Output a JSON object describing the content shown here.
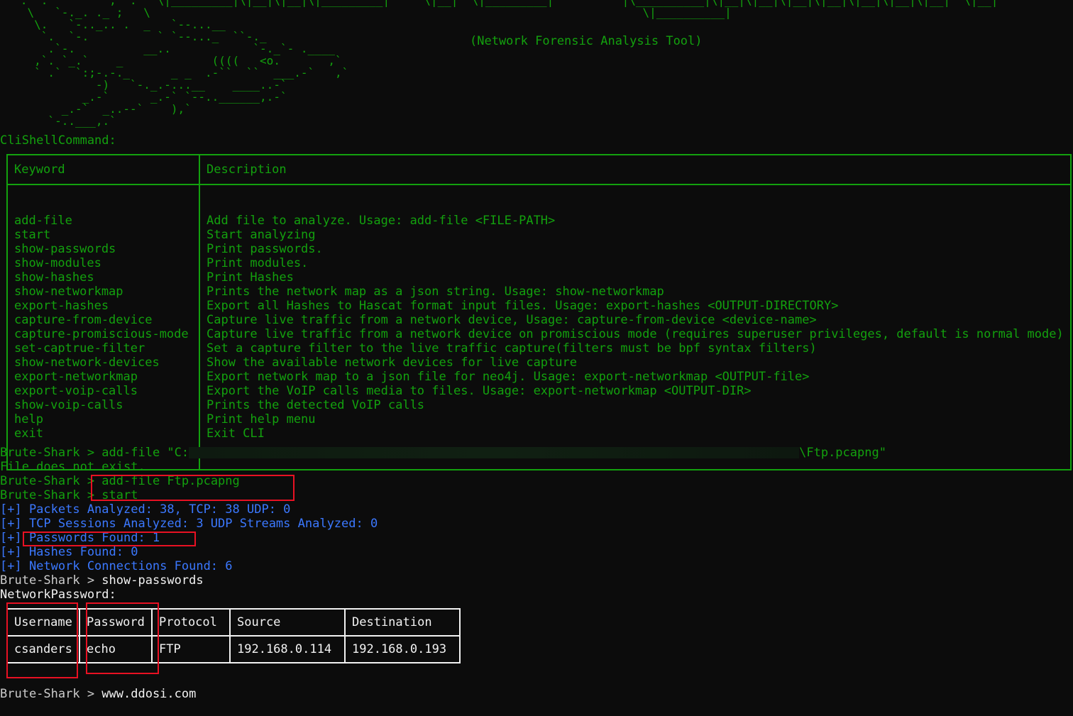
{
  "banner": "   .  .         ,  .   \\|_________|\\|__|\\|__|\\|_________|     \\|__|  \\|_________|          |\\__________|\\|__|\\|__|\\|__|\\|__|\\|__|\\|__|\\|__|  \\|__|\n    \\   `-._. ._ ;   \\                                                                        \\|__________|\n     \\.   `-.._.. .  _   `--...__\n      `.  `-.          ` `--..._  ``-._\n       .`-.          __..            `-._`- .____\n     ,`. `_.`    _             ((((   <o.       ,`\n     ` .`  `:;-.-._      _ _  .-``  ``  ___.-`   ,`\n              -)   `-._.-...__    ____..-`\n            _.-`      _.-` `--..______,.-`\n         _.-`  _..--`    ),`\n       `-..___,.`",
  "subtitle": "(Network Forensic Analysis Tool)",
  "cmd_title": "CliShellCommand:",
  "cmd_table": {
    "headers": [
      "Keyword",
      "Description"
    ],
    "rows": [
      [
        "add-file",
        "Add file to analyze. Usage: add-file <FILE-PATH>"
      ],
      [
        "start",
        "Start analyzing"
      ],
      [
        "show-passwords",
        "Print passwords."
      ],
      [
        "show-modules",
        "Print modules."
      ],
      [
        "show-hashes",
        "Print Hashes"
      ],
      [
        "show-networkmap",
        "Prints the network map as a json string. Usage: show-networkmap"
      ],
      [
        "export-hashes",
        "Export all Hashes to Hascat format input files. Usage: export-hashes <OUTPUT-DIRECTORY>"
      ],
      [
        "capture-from-device",
        "Capture live traffic from a network device, Usage: capture-from-device <device-name>"
      ],
      [
        "capture-promiscious-mode",
        "Capture live traffic from a network device on promiscious mode (requires superuser privileges, default is normal mode)"
      ],
      [
        "set-captrue-filter",
        "Set a capture filter to the live traffic capture(filters must be bpf syntax filters)"
      ],
      [
        "show-network-devices",
        "Show the available network devices for live capture"
      ],
      [
        "export-networkmap",
        "Export network map to a json file for neo4j. Usage: export-networkmap <OUTPUT-file>"
      ],
      [
        "export-voip-calls",
        "Export the VoIP calls media to files. Usage: export-networkmap <OUTPUT-DIR>"
      ],
      [
        "show-voip-calls",
        "Prints the detected VoIP calls"
      ],
      [
        "help",
        "Print help menu"
      ],
      [
        "exit",
        "Exit CLI"
      ]
    ]
  },
  "prompt": "Brute-Shark > ",
  "session": {
    "cmd1_start": "add-file \"C:",
    "cmd1_end": "\\Ftp.pcapng\"",
    "err1": "File does not exist.",
    "cmd2": "add-file Ftp.pcapng",
    "cmd3": "start",
    "stats": [
      "[+] Packets Analyzed: 38, TCP: 38 UDP: 0",
      "[+] TCP Sessions Analyzed: 3 UDP Streams Analyzed: 0",
      "[+] Passwords Found: 1",
      "[+] Hashes Found: 0",
      "[+] Network Connections Found: 6"
    ],
    "cmd4": "show-passwords",
    "pw_title": "NetworkPassword:",
    "cmd5": "www.ddosi.com"
  },
  "pw_table": {
    "headers": [
      "Username",
      "Password",
      "Protocol",
      "Source",
      "Destination"
    ],
    "row": [
      "csanders",
      "echo",
      "FTP",
      "192.168.0.114",
      "192.168.0.193"
    ]
  },
  "colors": {
    "background": "#0c0c0c",
    "green": "#13a10e",
    "blue": "#3b78ff",
    "white": "#cccccc",
    "highlight_red": "#e81123"
  }
}
